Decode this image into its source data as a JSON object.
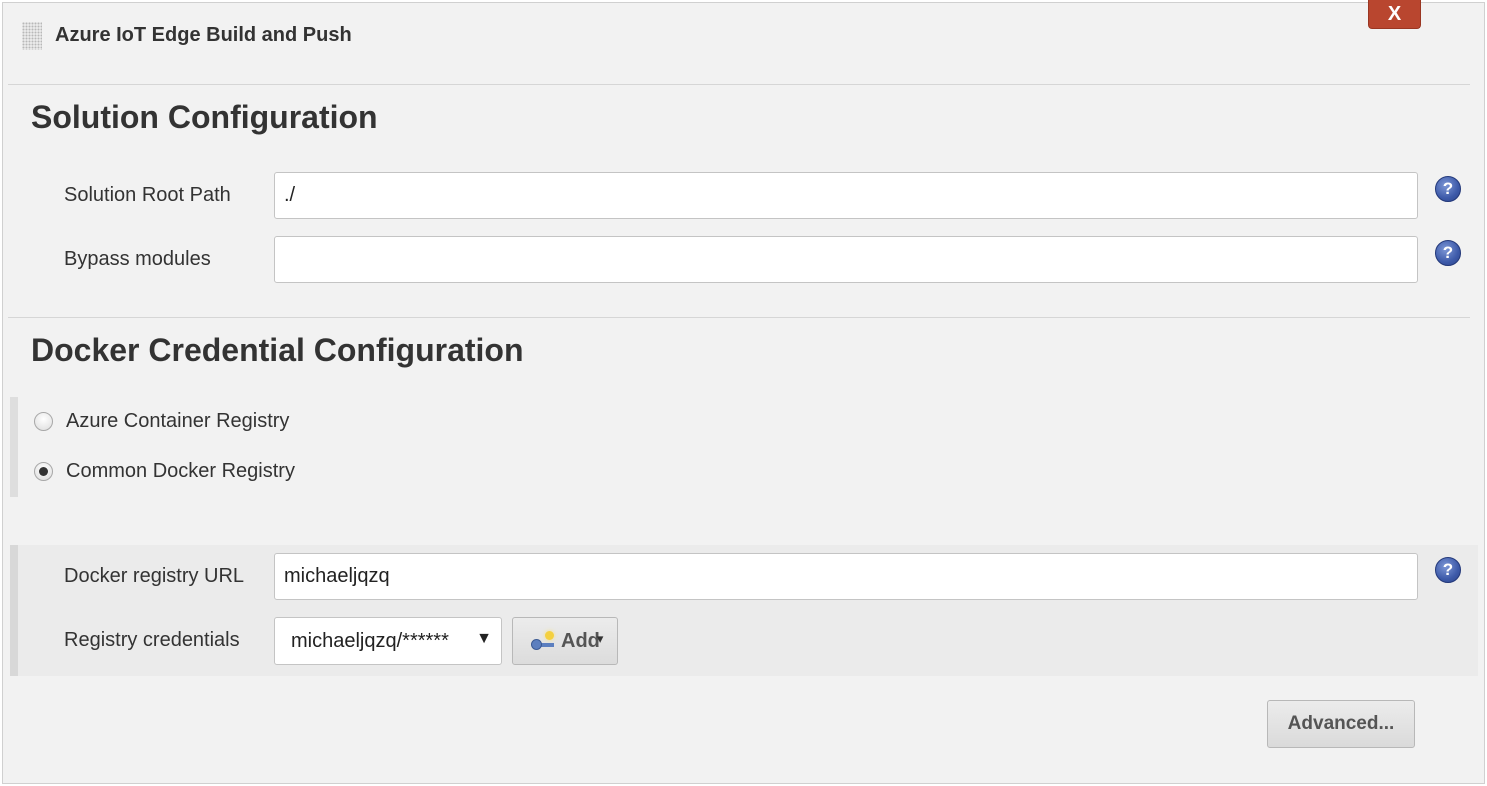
{
  "step": {
    "title": "Azure IoT Edge Build and Push",
    "close_label": "X"
  },
  "solution": {
    "heading": "Solution Configuration",
    "root_path_label": "Solution Root Path",
    "root_path_value": "./",
    "bypass_label": "Bypass modules",
    "bypass_value": ""
  },
  "docker": {
    "heading": "Docker Credential Configuration",
    "options": [
      {
        "label": "Azure Container Registry",
        "selected": false
      },
      {
        "label": "Common Docker Registry",
        "selected": true
      }
    ],
    "registry_url_label": "Docker registry URL",
    "registry_url_value": "michaeljqzq",
    "credentials_label": "Registry credentials",
    "credentials_selected": "michaeljqzq/******",
    "add_label": "Add"
  },
  "help_icon_glyph": "?",
  "advanced_label": "Advanced...",
  "colors": {
    "close_button": "#b9462f",
    "help_icon": "#3d5aa9",
    "panel_background": "#f2f2f2"
  },
  "icons": [
    "drag-handle-icon",
    "help-icon",
    "key-icon",
    "dropdown-arrow-icon"
  ]
}
